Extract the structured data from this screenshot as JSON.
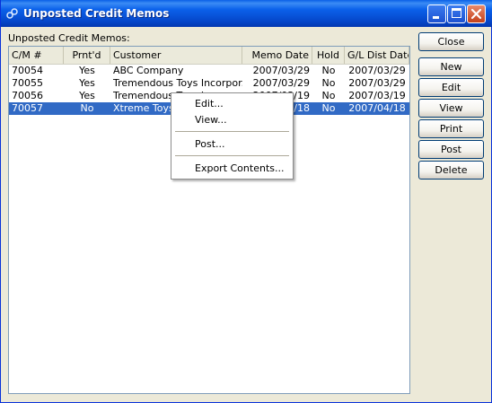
{
  "window": {
    "title": "Unposted Credit Memos"
  },
  "list_label": "Unposted Credit Memos:",
  "columns": [
    "C/M #",
    "Prnt'd",
    "Customer",
    "Memo Date",
    "Hold",
    "G/L Dist Date"
  ],
  "rows": [
    {
      "cm": "70054",
      "printed": "Yes",
      "customer": "ABC Company",
      "memo_date": "2007/03/29",
      "hold": "No",
      "gl_date": "2007/03/29"
    },
    {
      "cm": "70055",
      "printed": "Yes",
      "customer": "Tremendous Toys Incorpor...",
      "memo_date": "2007/03/29",
      "hold": "No",
      "gl_date": "2007/03/29"
    },
    {
      "cm": "70056",
      "printed": "Yes",
      "customer": "Tremendous Toys Inc",
      "memo_date": "2007/03/19",
      "hold": "No",
      "gl_date": "2007/03/19"
    },
    {
      "cm": "70057",
      "printed": "No",
      "customer": "Xtreme Toys LTD",
      "memo_date": "2007/04/18",
      "hold": "No",
      "gl_date": "2007/04/18"
    }
  ],
  "selected_row": 3,
  "buttons": {
    "close": "Close",
    "new": "New",
    "edit": "Edit",
    "view": "View",
    "print": "Print",
    "post": "Post",
    "delete": "Delete"
  },
  "context_menu": {
    "edit": "Edit...",
    "view": "View...",
    "post": "Post...",
    "export": "Export Contents..."
  },
  "icons": {
    "app": "app-icon",
    "minimize": "minimize-icon",
    "maximize": "maximize-icon",
    "close": "close-icon"
  },
  "colors": {
    "titlebar": "#0b61ea",
    "selection": "#316ac5",
    "face": "#ece9d8"
  }
}
